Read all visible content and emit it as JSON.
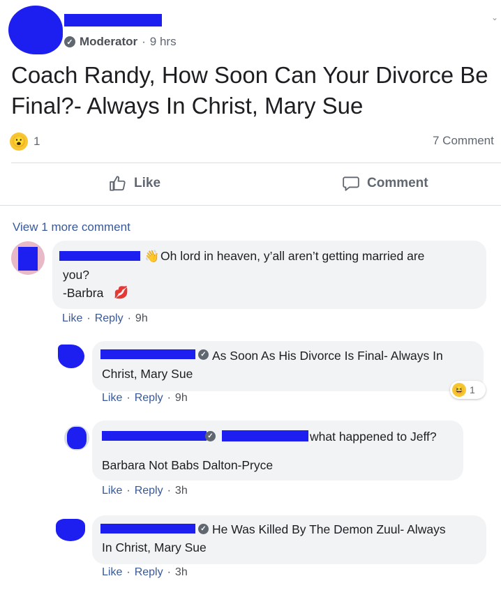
{
  "post": {
    "role": "Moderator",
    "separator": "·",
    "time": "9 hrs",
    "title": "Coach Randy, How Soon Can Your Divorce Be Final?- Always In Christ, Mary Sue",
    "reaction_count": "1",
    "comment_count": "7 Comment"
  },
  "actions": {
    "like": "Like",
    "comment": "Comment"
  },
  "view_more": "View 1 more comment",
  "comments": [
    {
      "text_line1": "Oh lord in heaven, y’all aren’t getting married are",
      "text_line2": "you?",
      "text_line3": "-Barbra",
      "like": "Like",
      "reply": "Reply",
      "time": "9h"
    },
    {
      "text_line1": "As Soon As His Divorce Is Final- Always In",
      "text_line2": "Christ, Mary Sue",
      "like": "Like",
      "reply": "Reply",
      "time": "9h",
      "reaction_count": "1"
    },
    {
      "text_line1": "what happened to Jeff?",
      "text_line2": "Barbara Not Babs Dalton-Pryce",
      "like": "Like",
      "reply": "Reply",
      "time": "3h"
    },
    {
      "text_line1": "He Was Killed By The Demon Zuul- Always",
      "text_line2": "In Christ, Mary Sue",
      "like": "Like",
      "reply": "Reply",
      "time": "3h"
    }
  ],
  "separator": "·",
  "colors": {
    "link": "#385898",
    "redaction": "#1d1ef0",
    "bubble": "#f2f3f5"
  }
}
